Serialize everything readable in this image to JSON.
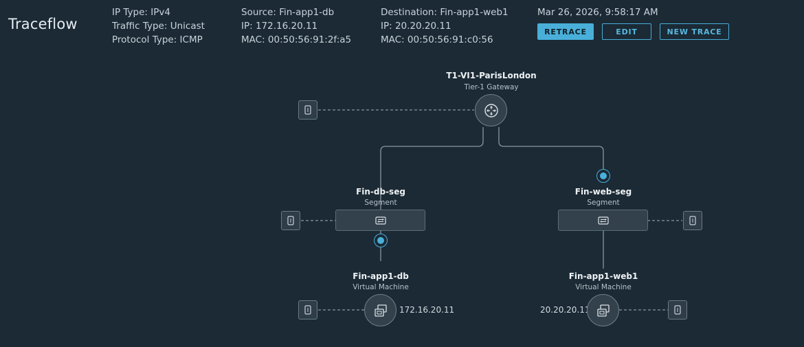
{
  "page": {
    "title": "Traceflow"
  },
  "trace_info": {
    "ip_type_label": "IP Type:",
    "ip_type_value": "IPv4",
    "traffic_type_label": "Traffic Type:",
    "traffic_type_value": "Unicast",
    "protocol_type_label": "Protocol Type:",
    "protocol_type_value": "ICMP"
  },
  "source": {
    "source_label": "Source:",
    "source_value": "Fin-app1-db",
    "ip_label": "IP:",
    "ip_value": "172.16.20.11",
    "mac_label": "MAC:",
    "mac_value": "00:50:56:91:2f:a5"
  },
  "destination": {
    "destination_label": "Destination:",
    "destination_value": "Fin-app1-web1",
    "ip_label": "IP:",
    "ip_value": "20.20.20.11",
    "mac_label": "MAC:",
    "mac_value": "00:50:56:91:c0:56"
  },
  "timestamp": "Mar 26, 2026, 9:58:17 AM",
  "actions": {
    "retrace_label": "RETRACE",
    "edit_label": "EDIT",
    "new_trace_label": "NEW TRACE"
  },
  "topology": {
    "gateway": {
      "name": "T1-VI1-ParisLondon",
      "type": "Tier-1 Gateway"
    },
    "segment_db": {
      "name": "Fin-db-seg",
      "type": "Segment"
    },
    "segment_web": {
      "name": "Fin-web-seg",
      "type": "Segment"
    },
    "vm_db": {
      "name": "Fin-app1-db",
      "type": "Virtual Machine",
      "ip": "172.16.20.11"
    },
    "vm_web": {
      "name": "Fin-app1-web1",
      "type": "Virtual Machine",
      "ip": "20.20.20.11"
    }
  },
  "colors": {
    "background": "#1b2a35",
    "accent": "#49afd9",
    "node_fill": "#33414c",
    "line": "#8a979f"
  },
  "icons": {
    "gateway": "router-icon",
    "segment": "switch-icon",
    "vm": "virtual-machine-icon",
    "port": "port-icon",
    "marker": "trace-marker-icon"
  }
}
